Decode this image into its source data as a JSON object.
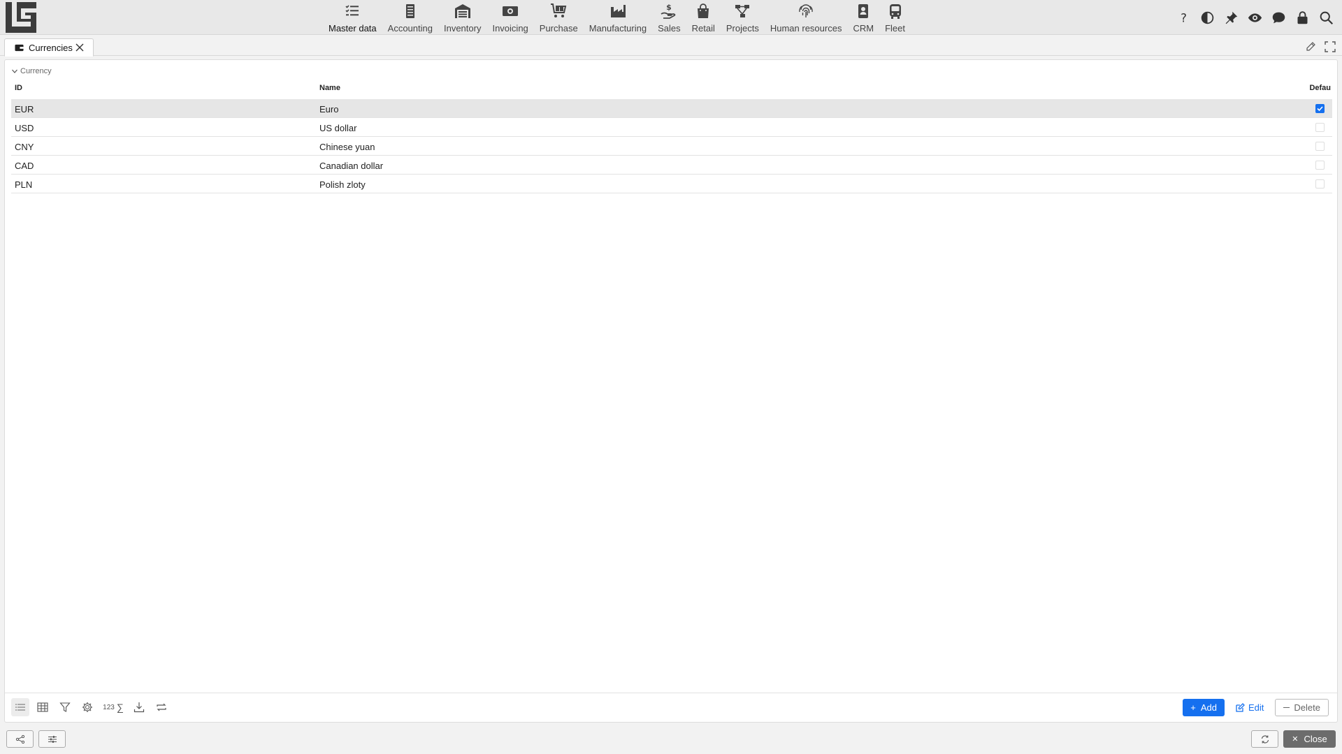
{
  "topbar": {
    "logo_icon": "company-logo-icon",
    "modules": [
      {
        "label": "Master data",
        "icon": "checklist-icon",
        "active": true
      },
      {
        "label": "Accounting",
        "icon": "ledger-icon"
      },
      {
        "label": "Inventory",
        "icon": "warehouse-icon"
      },
      {
        "label": "Invoicing",
        "icon": "banknote-icon"
      },
      {
        "label": "Purchase",
        "icon": "cart-icon"
      },
      {
        "label": "Manufacturing",
        "icon": "factory-icon"
      },
      {
        "label": "Sales",
        "icon": "hand-coin-icon"
      },
      {
        "label": "Retail",
        "icon": "shopping-bag-icon"
      },
      {
        "label": "Projects",
        "icon": "project-tree-icon"
      },
      {
        "label": "Human resources",
        "icon": "fingerprint-icon"
      },
      {
        "label": "CRM",
        "icon": "contact-card-icon"
      },
      {
        "label": "Fleet",
        "icon": "bus-icon"
      }
    ],
    "right_icons": [
      "help-icon",
      "contrast-icon",
      "pin-icon",
      "eye-icon",
      "chat-icon",
      "lock-icon",
      "search-icon"
    ]
  },
  "tabs": [
    {
      "label": "Currencies",
      "icon": "wallet-icon",
      "close_icon": "close-icon"
    }
  ],
  "panel": {
    "group_label": "Currency",
    "columns": {
      "id": "ID",
      "name": "Name",
      "default": "Defau"
    },
    "rows": [
      {
        "id": "EUR",
        "name": "Euro",
        "default": true
      },
      {
        "id": "USD",
        "name": "US dollar",
        "default": false
      },
      {
        "id": "CNY",
        "name": "Chinese yuan",
        "default": false
      },
      {
        "id": "CAD",
        "name": "Canadian dollar",
        "default": false
      },
      {
        "id": "PLN",
        "name": "Polish zloty",
        "default": false
      }
    ],
    "toolbar": {
      "number_label": "123",
      "sum_label": "∑",
      "add_label": "Add",
      "edit_label": "Edit",
      "delete_label": "Delete"
    }
  },
  "footer": {
    "close_label": "Close"
  },
  "colors": {
    "accent": "#1570ef",
    "topbar_bg": "#e8e8e8",
    "close_button_bg": "#6c6c6c"
  }
}
